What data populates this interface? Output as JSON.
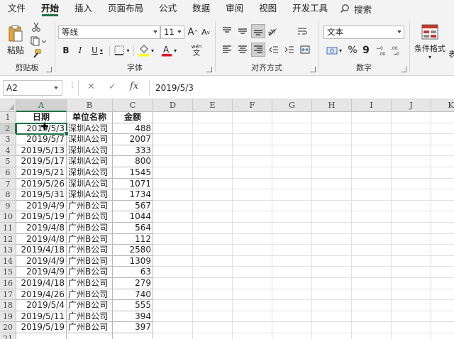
{
  "menu": {
    "tabs": [
      "文件",
      "开始",
      "插入",
      "页面布局",
      "公式",
      "数据",
      "审阅",
      "视图",
      "开发工具"
    ],
    "active_index": 1,
    "search_label": "搜索"
  },
  "ribbon": {
    "clipboard": {
      "label": "剪贴板",
      "paste_label": "粘贴"
    },
    "font": {
      "label": "字体",
      "font_name": "等线",
      "font_size": "11",
      "bold": "B",
      "italic": "I",
      "underline": "U",
      "grow": "A",
      "shrink": "A",
      "phonetic_top": "wén",
      "phonetic_bottom": "文"
    },
    "alignment": {
      "label": "对齐方式"
    },
    "number": {
      "label": "数字",
      "format": "文本",
      "percent": "%",
      "comma": "9"
    },
    "styles": {
      "conditional_format": "条件格式",
      "table_format_partial": "表"
    }
  },
  "formula_bar": {
    "name_box": "A2",
    "fx": "fx",
    "value": "2019/5/3"
  },
  "grid": {
    "columns": [
      "A",
      "B",
      "C",
      "D",
      "E",
      "F",
      "G",
      "H",
      "I",
      "J",
      "K"
    ],
    "selected_column": "A",
    "selected_row": 2,
    "header_row": [
      "日期",
      "单位名称",
      "金额"
    ],
    "rows": [
      {
        "row": 2,
        "date": "2019/5/3",
        "unit": "深圳A公司",
        "amount": "488"
      },
      {
        "row": 3,
        "date": "2019/5/7",
        "unit": "深圳A公司",
        "amount": "2007"
      },
      {
        "row": 4,
        "date": "2019/5/13",
        "unit": "深圳A公司",
        "amount": "333"
      },
      {
        "row": 5,
        "date": "2019/5/17",
        "unit": "深圳A公司",
        "amount": "800"
      },
      {
        "row": 6,
        "date": "2019/5/21",
        "unit": "深圳A公司",
        "amount": "1545"
      },
      {
        "row": 7,
        "date": "2019/5/26",
        "unit": "深圳A公司",
        "amount": "1071"
      },
      {
        "row": 8,
        "date": "2019/5/31",
        "unit": "深圳A公司",
        "amount": "1734"
      },
      {
        "row": 9,
        "date": "2019/4/9",
        "unit": "广州B公司",
        "amount": "567"
      },
      {
        "row": 10,
        "date": "2019/5/19",
        "unit": "广州B公司",
        "amount": "1044"
      },
      {
        "row": 11,
        "date": "2019/4/8",
        "unit": "广州B公司",
        "amount": "564"
      },
      {
        "row": 12,
        "date": "2019/4/8",
        "unit": "广州B公司",
        "amount": "112"
      },
      {
        "row": 13,
        "date": "2019/4/18",
        "unit": "广州B公司",
        "amount": "2580"
      },
      {
        "row": 14,
        "date": "2019/4/9",
        "unit": "广州B公司",
        "amount": "1309"
      },
      {
        "row": 15,
        "date": "2019/4/9",
        "unit": "广州B公司",
        "amount": "63"
      },
      {
        "row": 16,
        "date": "2019/4/18",
        "unit": "广州B公司",
        "amount": "279"
      },
      {
        "row": 17,
        "date": "2019/4/26",
        "unit": "广州B公司",
        "amount": "740"
      },
      {
        "row": 18,
        "date": "2019/5/4",
        "unit": "广州B公司",
        "amount": "555"
      },
      {
        "row": 19,
        "date": "2019/5/11",
        "unit": "广州B公司",
        "amount": "394"
      },
      {
        "row": 20,
        "date": "2019/5/19",
        "unit": "广州B公司",
        "amount": "397"
      },
      {
        "row": 21,
        "date": "",
        "unit": "",
        "amount": ""
      }
    ]
  },
  "colors": {
    "accent": "#217346"
  }
}
